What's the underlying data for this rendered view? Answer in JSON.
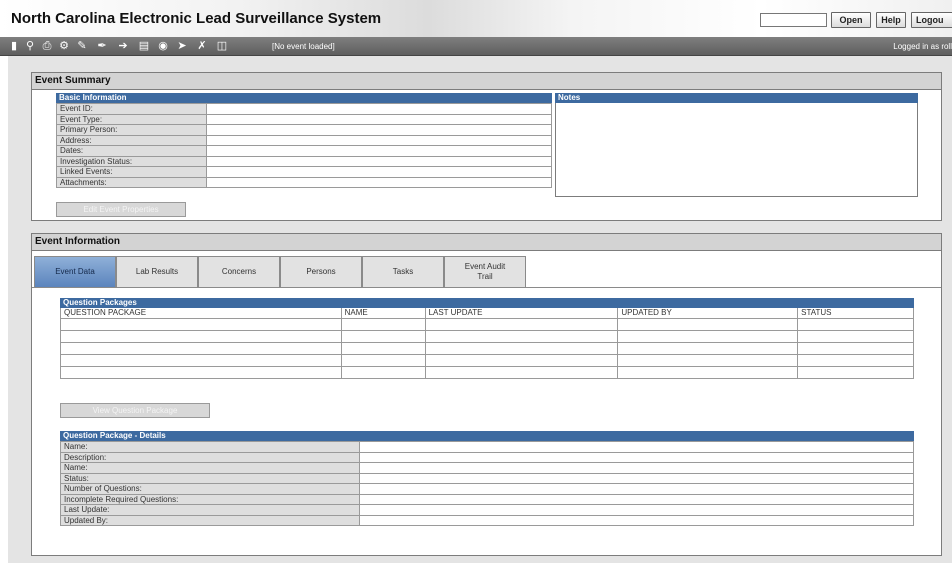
{
  "app": {
    "title": "North Carolina Electronic Lead Surveillance System",
    "header_buttons": {
      "open": "Open",
      "help": "Help",
      "logout": "Logou"
    }
  },
  "toolbar": {
    "status": "[No event loaded]",
    "user": "Logged in as roll",
    "icons": [
      "new-document-icon",
      "search-icon",
      "print-icon",
      "settings-icon",
      "edit-icon",
      "signature-icon",
      "arrow-right-icon",
      "document-icon",
      "lock-icon",
      "forward-icon",
      "tools-icon",
      "trash-icon"
    ]
  },
  "event_summary": {
    "title": "Event Summary",
    "basic_info_title": "Basic Information",
    "notes_title": "Notes",
    "fields": [
      {
        "label": "Event ID:",
        "value": ""
      },
      {
        "label": "Event Type:",
        "value": ""
      },
      {
        "label": "Primary Person:",
        "value": ""
      },
      {
        "label": "Address:",
        "value": ""
      },
      {
        "label": "Dates:",
        "value": ""
      },
      {
        "label": "Investigation Status:",
        "value": ""
      },
      {
        "label": "Linked Events:",
        "value": ""
      },
      {
        "label": "Attachments:",
        "value": ""
      }
    ],
    "edit_button": "Edit Event Properties"
  },
  "event_info": {
    "title": "Event Information",
    "tabs": [
      "Event Data",
      "Lab Results",
      "Concerns",
      "Persons",
      "Tasks",
      "Event Audit Trail"
    ],
    "active_tab": "Event Data",
    "question_packages": {
      "title": "Question Packages",
      "columns": [
        "QUESTION PACKAGE",
        "NAME",
        "LAST UPDATE",
        "UPDATED BY",
        "STATUS"
      ],
      "rows": [
        [
          "",
          "",
          "",
          "",
          ""
        ],
        [
          "",
          "",
          "",
          "",
          ""
        ],
        [
          "",
          "",
          "",
          "",
          ""
        ],
        [
          "",
          "",
          "",
          "",
          ""
        ],
        [
          "",
          "",
          "",
          "",
          ""
        ]
      ]
    },
    "view_button": "View Question Package",
    "details": {
      "title": "Question Package - Details",
      "fields": [
        {
          "label": "Name:",
          "value": ""
        },
        {
          "label": "Description:",
          "value": ""
        },
        {
          "label": "Name:",
          "value": ""
        },
        {
          "label": "Status:",
          "value": ""
        },
        {
          "label": "Number of Questions:",
          "value": ""
        },
        {
          "label": "Incomplete Required Questions:",
          "value": ""
        },
        {
          "label": "Last Update:",
          "value": ""
        },
        {
          "label": "Updated By:",
          "value": ""
        }
      ]
    }
  }
}
